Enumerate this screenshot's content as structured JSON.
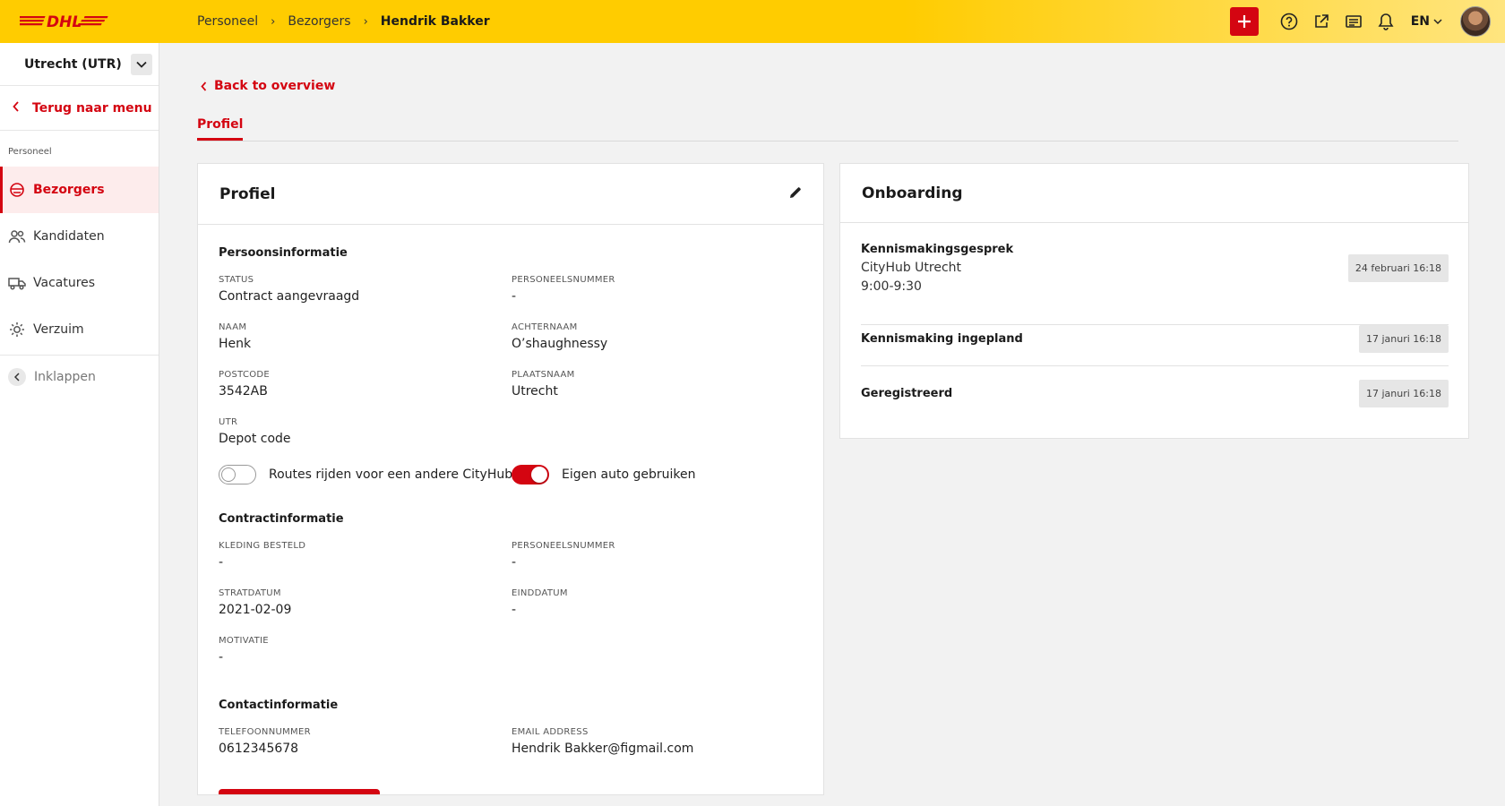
{
  "brand": {
    "logo": "DHL",
    "accent": "#d40511",
    "yellow": "#ffcc00"
  },
  "breadcrumb": [
    "Personeel",
    "Bezorgers",
    "Hendrik Bakker"
  ],
  "topbar": {
    "lang": "EN",
    "icons": [
      "plus-icon",
      "help-icon",
      "external-link-icon",
      "id-card-icon",
      "bell-icon"
    ]
  },
  "sidebar": {
    "depot": "Utrecht (UTR)",
    "back": "Terug naar menu",
    "section": "Personeel",
    "items": [
      {
        "label": "Bezorgers",
        "icon": "courier-icon",
        "active": true
      },
      {
        "label": "Kandidaten",
        "icon": "people-icon"
      },
      {
        "label": "Vacatures",
        "icon": "truck-icon"
      },
      {
        "label": "Verzuim",
        "icon": "sun-icon"
      }
    ],
    "collapse": "Inklappen"
  },
  "main": {
    "back_link": "Back to overview",
    "tab": "Profiel"
  },
  "profile": {
    "title": "Profiel",
    "personal": {
      "title": "Persoonsinformatie",
      "status_label": "STATUS",
      "status": "Contract aangevraagd",
      "pnr_label": "PERSONEELSNUMMER",
      "pnr": "-",
      "naam_label": "NAAM",
      "naam": "Henk",
      "achternaam_label": "ACHTERNAAM",
      "achternaam": "O’shaughnessy",
      "postcode_label": "POSTCODE",
      "postcode": "3542AB",
      "plaats_label": "PLAATSNAAM",
      "plaats": "Utrecht",
      "utr_label": "UTR",
      "utr": "Depot code",
      "toggle1": "Routes rijden voor een andere CityHub",
      "toggle1_on": false,
      "toggle2": "Eigen auto gebruiken",
      "toggle2_on": true
    },
    "contract": {
      "title": "Contractinformatie",
      "kleding_label": "KLEDING BESTELD",
      "kleding": "-",
      "pnr_label": "PERSONEELSNUMMER",
      "pnr": "-",
      "start_label": "STRATDATUM",
      "start": "2021-02-09",
      "eind_label": "EINDDATUM",
      "eind": "-",
      "motivatie_label": "MOTIVATIE",
      "motivatie": "-"
    },
    "contact": {
      "title": "Contactinformatie",
      "tel_label": "TELEFOONNUMMER",
      "tel": "0612345678",
      "email_label": "EMAIL ADDRESS",
      "email": "Hendrik Bakker@figmail.com"
    }
  },
  "onboarding": {
    "title": "Onboarding",
    "items": [
      {
        "title": "Kennismakingsgesprek",
        "sub1": "CityHub Utrecht",
        "sub2": "9:00-9:30",
        "date": "24 februari 16:18"
      },
      {
        "title": "Kennismaking ingepland",
        "date": "17 januri 16:18"
      },
      {
        "title": "Geregistreerd",
        "date": "17 januri 16:18"
      }
    ]
  }
}
